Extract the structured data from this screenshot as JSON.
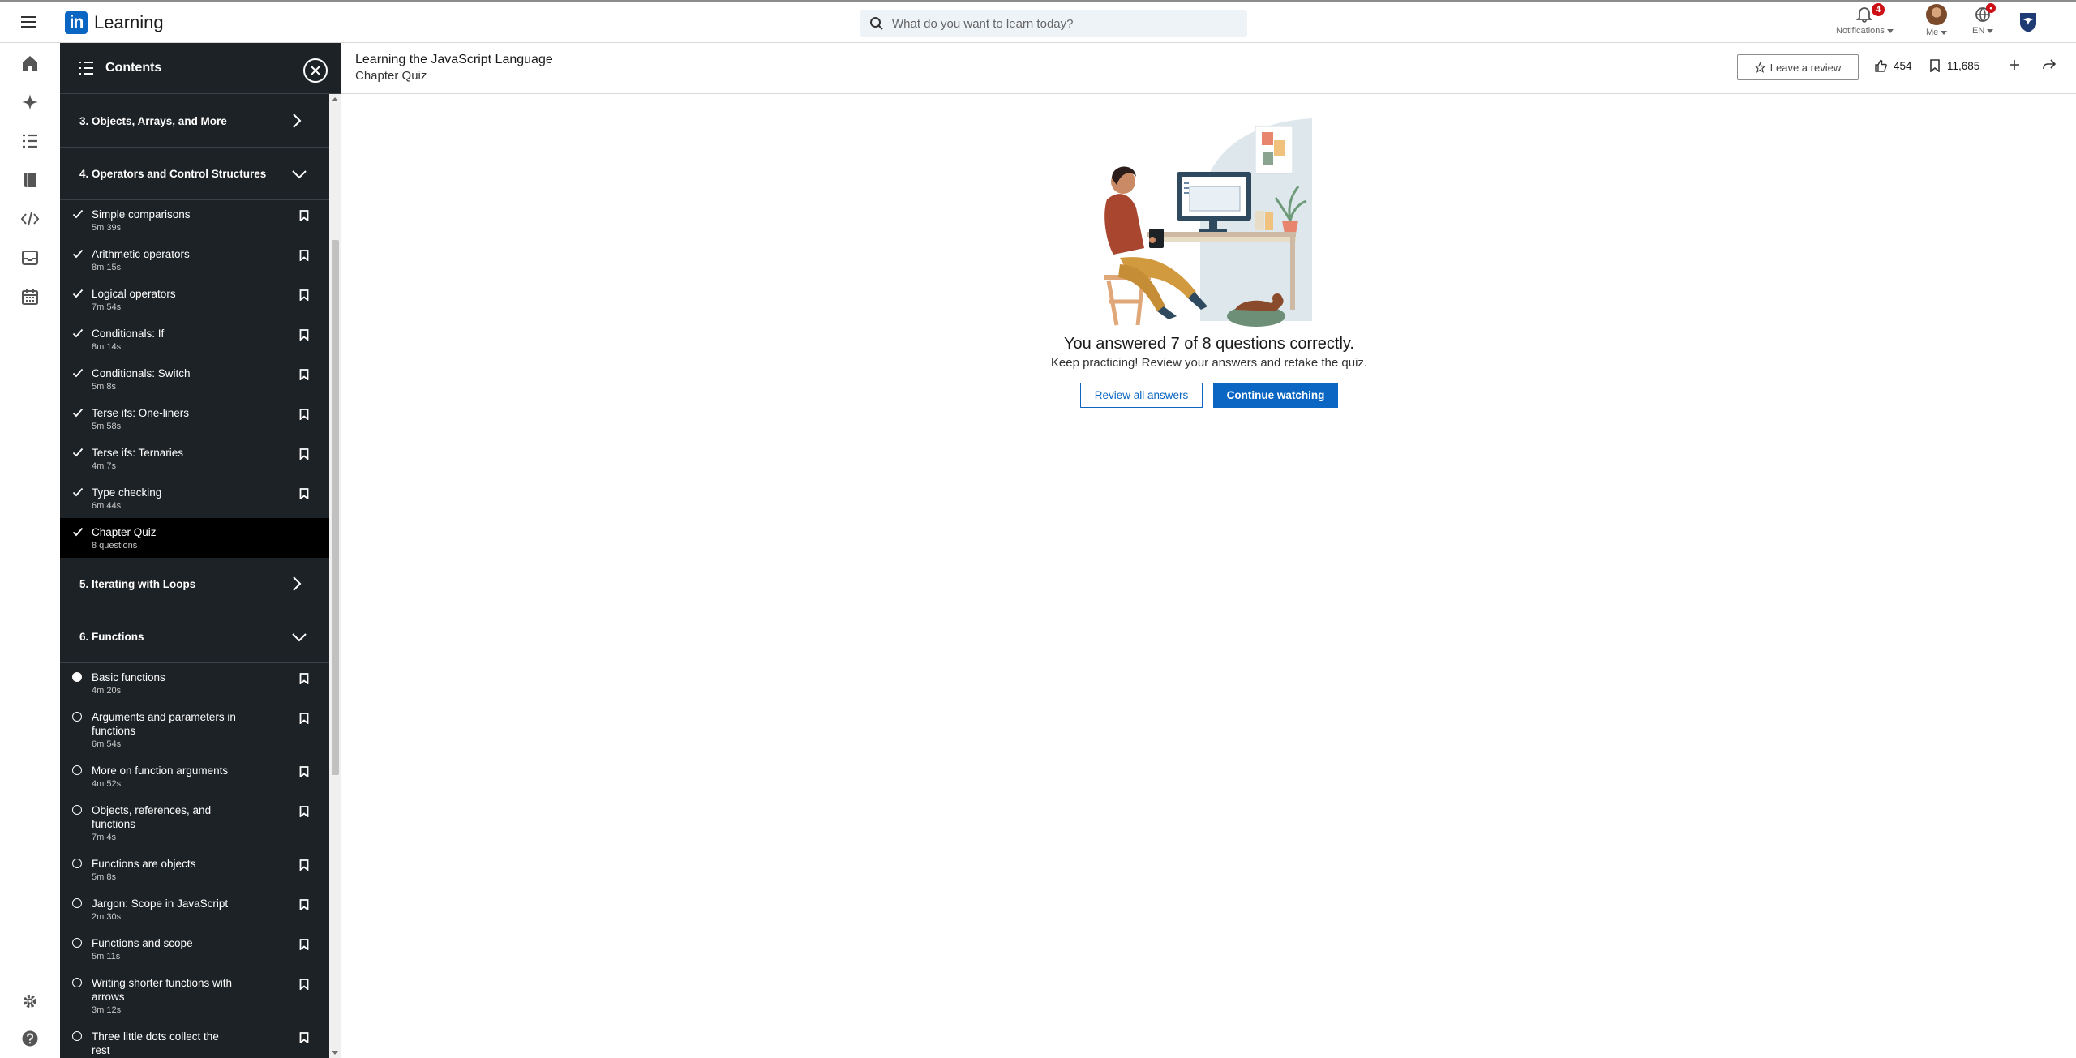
{
  "app": {
    "brand_logo": "in",
    "brand_name": "Learning",
    "search_placeholder": "What do you want to learn today?",
    "notifications": {
      "label": "Notifications",
      "badge": "4"
    },
    "me": {
      "label": "Me"
    },
    "language": {
      "label": "EN",
      "badge": "•"
    }
  },
  "rail": {
    "icons": [
      "home-icon",
      "sparkle-icon",
      "list-icon",
      "book-icon",
      "code-icon",
      "inbox-icon",
      "calendar-icon",
      "settings-icon",
      "help-icon"
    ]
  },
  "contents": {
    "title": "Contents",
    "chapters": [
      {
        "title": "3. Objects, Arrays, and More",
        "expanded": false
      },
      {
        "title": "4. Operators and Control Structures",
        "expanded": true,
        "items": [
          {
            "title": "Simple comparisons",
            "duration": "5m 39s",
            "status": "done"
          },
          {
            "title": "Arithmetic operators",
            "duration": "8m 15s",
            "status": "done"
          },
          {
            "title": "Logical operators",
            "duration": "7m 54s",
            "status": "done"
          },
          {
            "title": "Conditionals: If",
            "duration": "8m 14s",
            "status": "done"
          },
          {
            "title": "Conditionals: Switch",
            "duration": "5m 8s",
            "status": "done"
          },
          {
            "title": "Terse ifs: One-liners",
            "duration": "5m 58s",
            "status": "done"
          },
          {
            "title": "Terse ifs: Ternaries",
            "duration": "4m 7s",
            "status": "done"
          },
          {
            "title": "Type checking",
            "duration": "6m 44s",
            "status": "done"
          },
          {
            "title": "Chapter Quiz",
            "duration": "8 questions",
            "status": "done",
            "active": true
          }
        ]
      },
      {
        "title": "5. Iterating with Loops",
        "expanded": false
      },
      {
        "title": "6. Functions",
        "expanded": true,
        "items": [
          {
            "title": "Basic functions",
            "duration": "4m 20s",
            "status": "current"
          },
          {
            "title": "Arguments and parameters in functions",
            "duration": "6m 54s",
            "status": "todo"
          },
          {
            "title": "More on function arguments",
            "duration": "4m 52s",
            "status": "todo"
          },
          {
            "title": "Objects, references, and functions",
            "duration": "7m 4s",
            "status": "todo"
          },
          {
            "title": "Functions are objects",
            "duration": "5m 8s",
            "status": "todo"
          },
          {
            "title": "Jargon: Scope in JavaScript",
            "duration": "2m 30s",
            "status": "todo"
          },
          {
            "title": "Functions and scope",
            "duration": "5m 11s",
            "status": "todo"
          },
          {
            "title": "Writing shorter functions with arrows",
            "duration": "3m 12s",
            "status": "todo"
          },
          {
            "title": "Three little dots collect the rest",
            "duration": "",
            "status": "todo"
          }
        ]
      }
    ]
  },
  "course": {
    "title": "Learning the JavaScript Language",
    "subtitle": "Chapter Quiz",
    "review_label": "Leave a review",
    "likes": "454",
    "saves": "11,685"
  },
  "quiz": {
    "result": "You answered 7 of 8 questions correctly.",
    "hint": "Keep practicing! Review your answers and retake the quiz.",
    "review_button": "Review all answers",
    "continue_button": "Continue watching"
  },
  "colors": {
    "accent": "#0a66c2",
    "panel": "#1d2226",
    "badge": "#cc1016"
  }
}
